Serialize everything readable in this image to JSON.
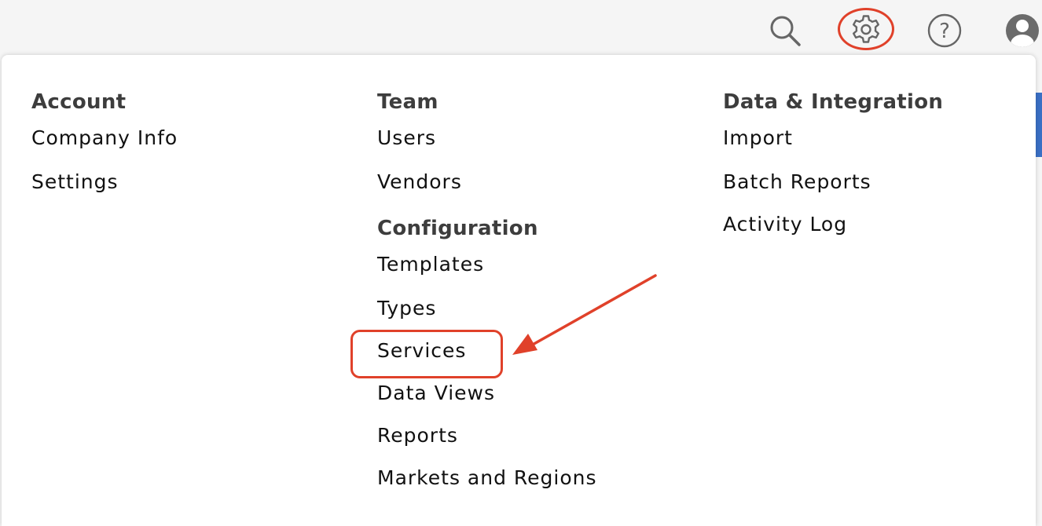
{
  "toolbar": {
    "icons": [
      "search-icon",
      "gear-icon",
      "help-icon",
      "avatar-icon"
    ],
    "help_glyph": "?"
  },
  "menu": {
    "account": {
      "title": "Account",
      "items": [
        "Company Info",
        "Settings"
      ]
    },
    "team": {
      "title": "Team",
      "items": [
        "Users",
        "Vendors"
      ]
    },
    "configuration": {
      "title": "Configuration",
      "items": [
        "Templates",
        "Types",
        "Services",
        "Data Views",
        "Reports",
        "Markets and Regions"
      ]
    },
    "data_integration": {
      "title": "Data & Integration",
      "items": [
        "Import",
        "Batch Reports",
        "Activity Log"
      ]
    }
  },
  "colors": {
    "annotation": "#e0412a",
    "accent": "#3a6fc4",
    "heading": "#3d3d3d",
    "text": "#111111"
  }
}
